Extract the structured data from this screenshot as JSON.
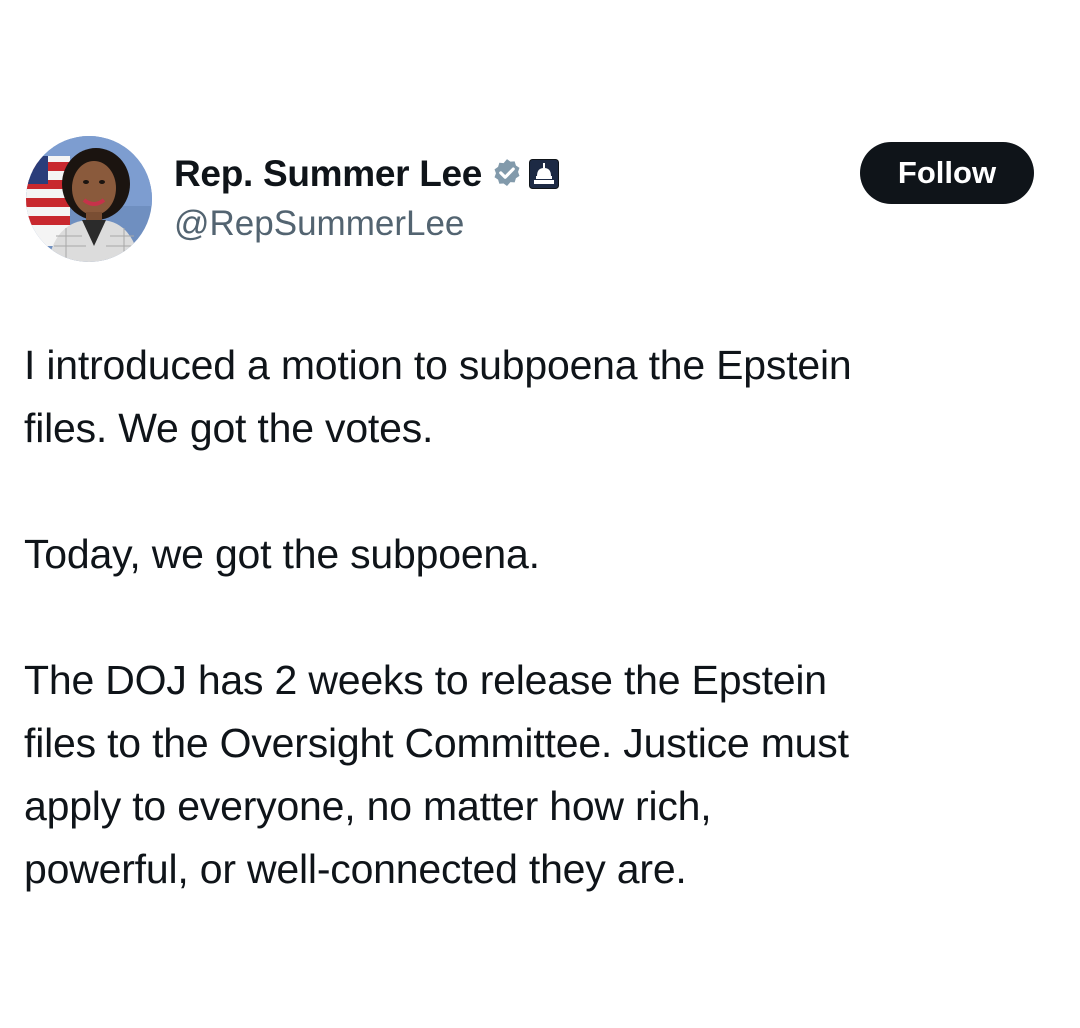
{
  "author": {
    "display_name": "Rep. Summer Lee",
    "handle": "@RepSummerLee",
    "verified_badge_icon": "verified-badge-icon",
    "affiliation_icon": "government-capitol-icon",
    "verified_color": "#829aab"
  },
  "actions": {
    "follow_label": "Follow"
  },
  "tweet": {
    "paragraphs": [
      "I introduced a motion to subpoena the Epstein\nfiles. We got the votes.",
      "Today, we got the subpoena.",
      "The DOJ has 2 weeks to release the Epstein\nfiles to the Oversight Committee. Justice must\napply to everyone, no matter how rich,\npowerful, or well-connected they are."
    ]
  }
}
